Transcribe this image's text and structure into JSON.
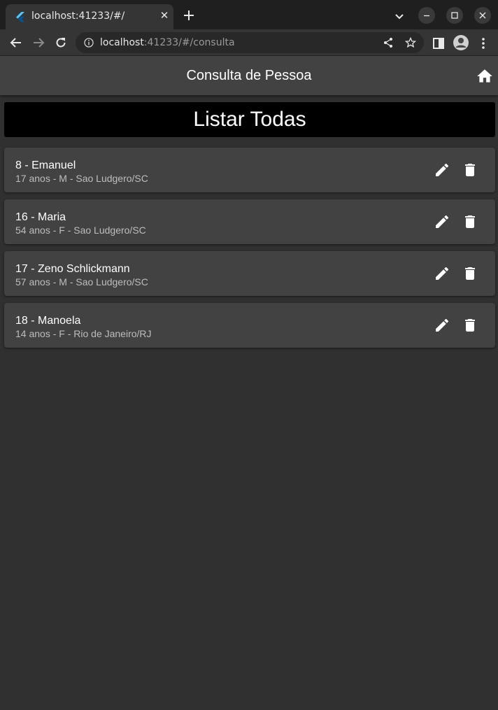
{
  "browser": {
    "tab_title": "localhost:41233/#/",
    "tab_close": "✕",
    "url_host": "localhost",
    "url_rest": ":41233/#/consulta"
  },
  "app": {
    "title": "Consulta de Pessoa",
    "list_all_label": "Listar Todas"
  },
  "people": [
    {
      "title": "8 - Emanuel",
      "subtitle": "17 anos - M - Sao Ludgero/SC"
    },
    {
      "title": "16 - Maria",
      "subtitle": "54 anos - F - Sao Ludgero/SC"
    },
    {
      "title": "17 - Zeno Schlickmann",
      "subtitle": "57 anos - M - Sao Ludgero/SC"
    },
    {
      "title": "18 - Manoela",
      "subtitle": "14 anos - F - Rio de Janeiro/RJ"
    }
  ],
  "colors": {
    "app_bar": "#424242",
    "background": "#303030",
    "card": "#424242",
    "button": "#000000"
  }
}
